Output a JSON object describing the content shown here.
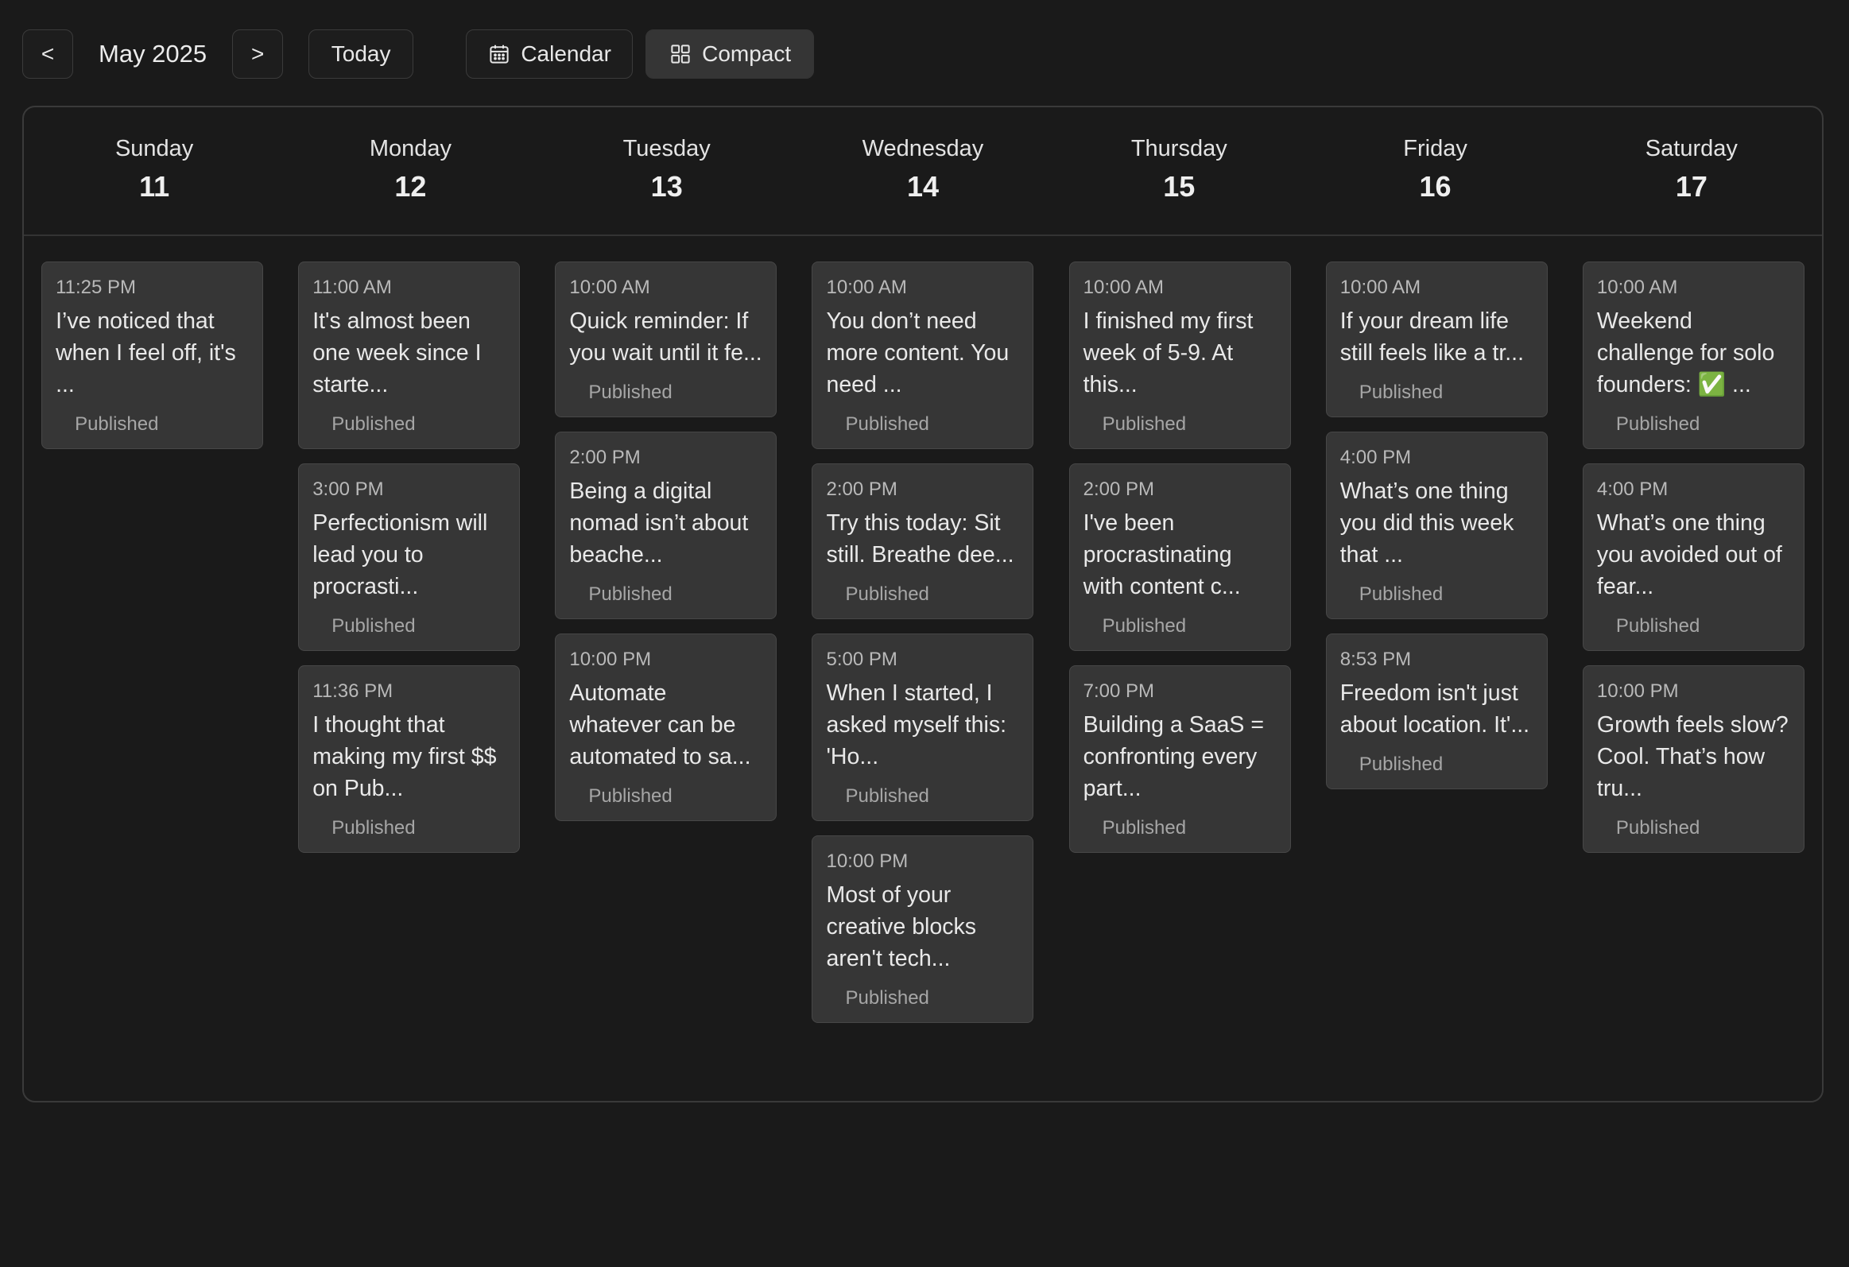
{
  "toolbar": {
    "prev_label": "<",
    "next_label": ">",
    "month": "May 2025",
    "today_label": "Today",
    "calendar_label": "Calendar",
    "compact_label": "Compact",
    "active_view": "Compact"
  },
  "days": [
    {
      "name": "Sunday",
      "date": "11",
      "posts": [
        {
          "time": "11:25 PM",
          "text": "I’ve noticed that when I feel off, it's ...",
          "status": "Published"
        }
      ]
    },
    {
      "name": "Monday",
      "date": "12",
      "posts": [
        {
          "time": "11:00 AM",
          "text": "It's almost been one week since I starte...",
          "status": "Published"
        },
        {
          "time": "3:00 PM",
          "text": "Perfectionism will lead you to procrasti...",
          "status": "Published"
        },
        {
          "time": "11:36 PM",
          "text": "I thought that making my first $$ on Pub...",
          "status": "Published"
        }
      ]
    },
    {
      "name": "Tuesday",
      "date": "13",
      "posts": [
        {
          "time": "10:00 AM",
          "text": "Quick reminder: If you wait until it fe...",
          "status": "Published"
        },
        {
          "time": "2:00 PM",
          "text": "Being a digital nomad isn’t about beache...",
          "status": "Published"
        },
        {
          "time": "10:00 PM",
          "text": "Automate whatever can be automated to sa...",
          "status": "Published"
        }
      ]
    },
    {
      "name": "Wednesday",
      "date": "14",
      "posts": [
        {
          "time": "10:00 AM",
          "text": "You don’t need more content. You need ...",
          "status": "Published"
        },
        {
          "time": "2:00 PM",
          "text": "Try this today: Sit still. Breathe dee...",
          "status": "Published"
        },
        {
          "time": "5:00 PM",
          "text": "When I started, I asked myself this: 'Ho...",
          "status": "Published"
        },
        {
          "time": "10:00 PM",
          "text": "Most of your creative blocks aren't tech...",
          "status": "Published"
        }
      ]
    },
    {
      "name": "Thursday",
      "date": "15",
      "posts": [
        {
          "time": "10:00 AM",
          "text": "I finished my first week of 5-9. At this...",
          "status": "Published"
        },
        {
          "time": "2:00 PM",
          "text": "I've been procrastinating with content c...",
          "status": "Published"
        },
        {
          "time": "7:00 PM",
          "text": "Building a SaaS = confronting every part...",
          "status": "Published"
        }
      ]
    },
    {
      "name": "Friday",
      "date": "16",
      "posts": [
        {
          "time": "10:00 AM",
          "text": "If your dream life still feels like a tr...",
          "status": "Published"
        },
        {
          "time": "4:00 PM",
          "text": "What’s one thing you did this week that ...",
          "status": "Published"
        },
        {
          "time": "8:53 PM",
          "text": "Freedom isn't just about location. It'...",
          "status": "Published"
        }
      ]
    },
    {
      "name": "Saturday",
      "date": "17",
      "posts": [
        {
          "time": "10:00 AM",
          "text": "Weekend challenge for solo founders: ✅ ...",
          "status": "Published"
        },
        {
          "time": "4:00 PM",
          "text": "What’s one thing you avoided out of fear...",
          "status": "Published"
        },
        {
          "time": "10:00 PM",
          "text": "Growth feels slow? Cool. That’s how tru...",
          "status": "Published"
        }
      ]
    }
  ]
}
